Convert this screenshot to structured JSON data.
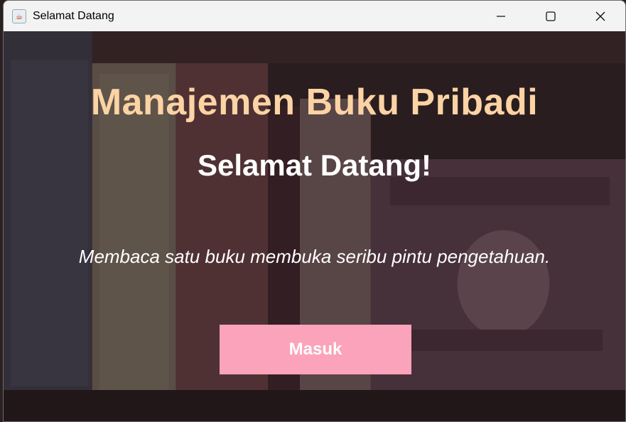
{
  "window": {
    "title": "Selamat Datang",
    "app_icon": "java-cup-icon",
    "controls": [
      "minimize-icon",
      "maximize-icon",
      "close-icon"
    ]
  },
  "main": {
    "heading": "Manajemen Buku Pribadi",
    "subheading": "Selamat Datang!",
    "quote": "Membaca satu buku membuka seribu pintu pengetahuan.",
    "button_label": "Masuk"
  },
  "colors": {
    "heading": "#fcd3a4",
    "subheading": "#ffffff",
    "button": "#fba3ba"
  }
}
